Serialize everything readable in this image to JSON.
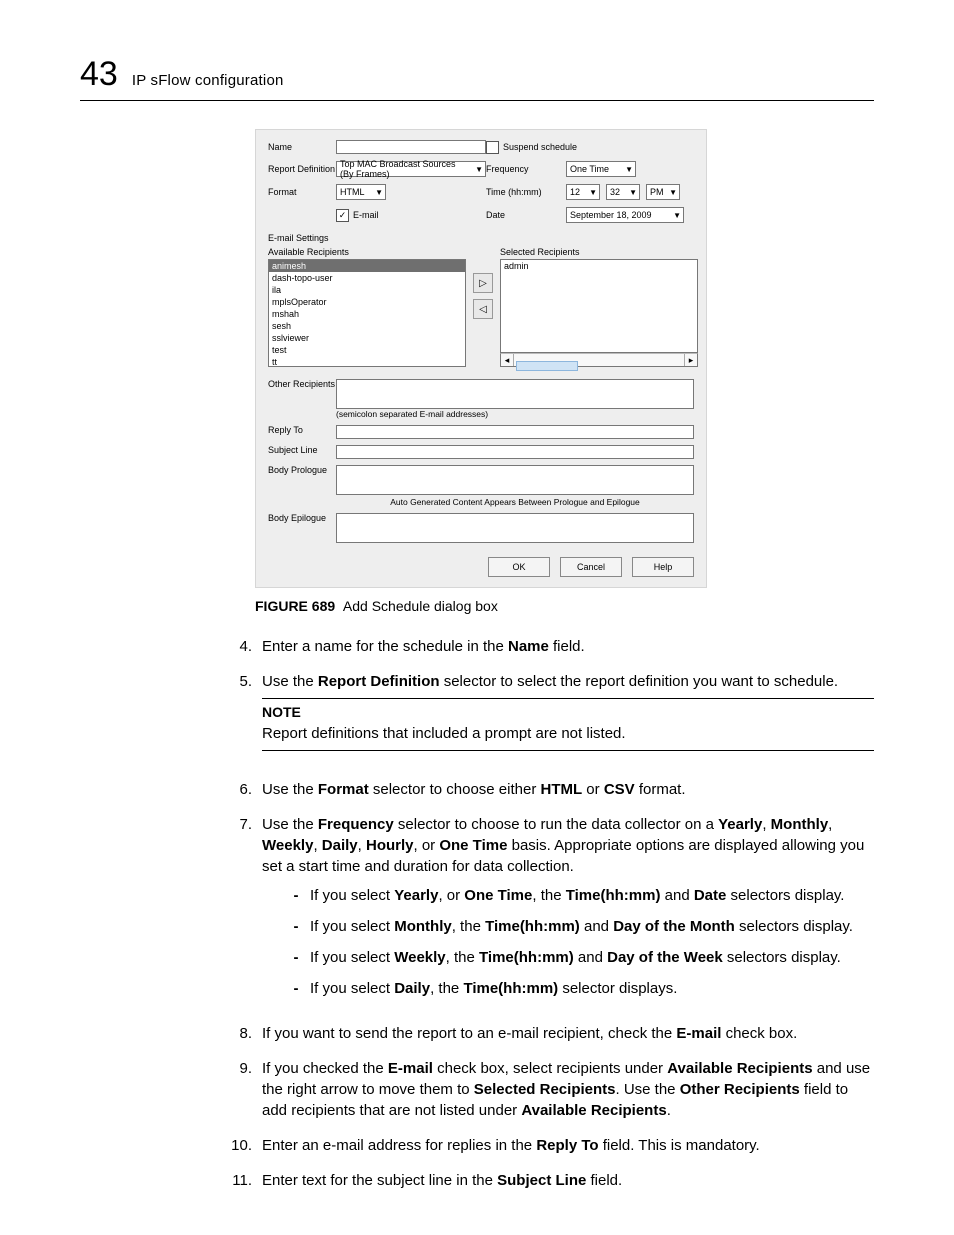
{
  "header": {
    "chapter_num": "43",
    "title": "IP sFlow configuration"
  },
  "dialog": {
    "labels": {
      "name": "Name",
      "report_definition": "Report Definition",
      "format": "Format",
      "email": "E-mail",
      "email_settings": "E-mail Settings",
      "suspend": "Suspend schedule",
      "frequency": "Frequency",
      "time": "Time (hh:mm)",
      "date": "Date",
      "available": "Available Recipients",
      "selected": "Selected Recipients",
      "other": "Other Recipients",
      "other_hint": "(semicolon separated E-mail addresses)",
      "reply_to": "Reply To",
      "subject": "Subject Line",
      "prologue": "Body Prologue",
      "epilogue": "Body Epilogue",
      "between_hint": "Auto Generated Content Appears Between Prologue and Epilogue"
    },
    "values": {
      "report_definition": "Top MAC Broadcast Sources (By Frames)",
      "format": "HTML",
      "frequency": "One Time",
      "time_h": "12",
      "time_m": "32",
      "time_ampm": "PM",
      "date": "September 18, 2009"
    },
    "recipients": {
      "available": [
        "animesh",
        "dash-topo-user",
        "ila",
        "mplsOperator",
        "mshah",
        "sesh",
        "sslviewer",
        "test",
        "tt"
      ],
      "available_selected_index": 0,
      "selected": [
        "admin"
      ]
    },
    "buttons": {
      "ok": "OK",
      "cancel": "Cancel",
      "help": "Help"
    }
  },
  "figure": {
    "label": "FIGURE 689",
    "caption": "Add Schedule dialog box"
  },
  "steps": {
    "s4": {
      "num": "4.",
      "p1a": "Enter a name for the schedule in the ",
      "b1": "Name",
      "p1b": " field."
    },
    "s5": {
      "num": "5.",
      "p1a": "Use the ",
      "b1": "Report Definition",
      "p1b": " selector to select the report definition you want to schedule."
    },
    "note": {
      "label": "NOTE",
      "text": "Report definitions that included a prompt are not listed."
    },
    "s6": {
      "num": "6.",
      "p1a": "Use the ",
      "b1": "Format",
      "p1b": " selector to choose either ",
      "b2": "HTML",
      "p1c": " or ",
      "b3": "CSV",
      "p1d": " format."
    },
    "s7": {
      "num": "7.",
      "p1a": "Use the ",
      "b1": "Frequency",
      "p1b": " selector to choose to run the data collector on a ",
      "b2": "Yearly",
      "c1": ", ",
      "b3": "Monthly",
      "c2": ", ",
      "b4": "Weekly",
      "c3": ", ",
      "b5": "Daily",
      "c4": ", ",
      "b6": "Hourly",
      "c5": ", or ",
      "b7": "One Time",
      "p1c": " basis. Appropriate options are displayed allowing you set a start time and duration for data collection.",
      "sub": {
        "a": {
          "p1a": "If you select ",
          "b1": "Yearly",
          "p1b": ", or ",
          "b2": "One Time",
          "p1c": ", the ",
          "b3": "Time(hh:mm)",
          "p1d": " and ",
          "b4": "Date",
          "p1e": " selectors display."
        },
        "b": {
          "p1a": "If you select ",
          "b1": "Monthly",
          "p1b": ", the ",
          "b2": "Time(hh:mm)",
          "p1c": " and ",
          "b3": "Day of the Month",
          "p1d": " selectors display."
        },
        "c": {
          "p1a": "If you select ",
          "b1": "Weekly",
          "p1b": ", the ",
          "b2": "Time(hh:mm)",
          "p1c": " and ",
          "b3": "Day of the Week",
          "p1d": " selectors display."
        },
        "d": {
          "p1a": "If you select ",
          "b1": "Daily",
          "p1b": ", the ",
          "b2": "Time(hh:mm)",
          "p1c": " selector displays."
        }
      }
    },
    "s8": {
      "num": "8.",
      "p1a": "If you want to send the report to an e-mail recipient, check the ",
      "b1": "E-mail",
      "p1b": " check box."
    },
    "s9": {
      "num": "9.",
      "p1a": "If you checked the ",
      "b1": "E-mail",
      "p1b": " check box, select recipients under ",
      "b2": "Available Recipients",
      "p1c": " and use the right arrow to move them to ",
      "b3": "Selected Recipients",
      "p1d": ". Use the ",
      "b4": "Other Recipients",
      "p1e": " field to add recipients that are not listed under ",
      "b5": "Available Recipients",
      "p1f": "."
    },
    "s10": {
      "num": "10.",
      "p1a": "Enter an e-mail address for replies in the ",
      "b1": "Reply To",
      "p1b": " field. This is mandatory."
    },
    "s11": {
      "num": "11.",
      "p1a": "Enter text for the subject line in the ",
      "b1": "Subject Line",
      "p1b": " field."
    }
  }
}
